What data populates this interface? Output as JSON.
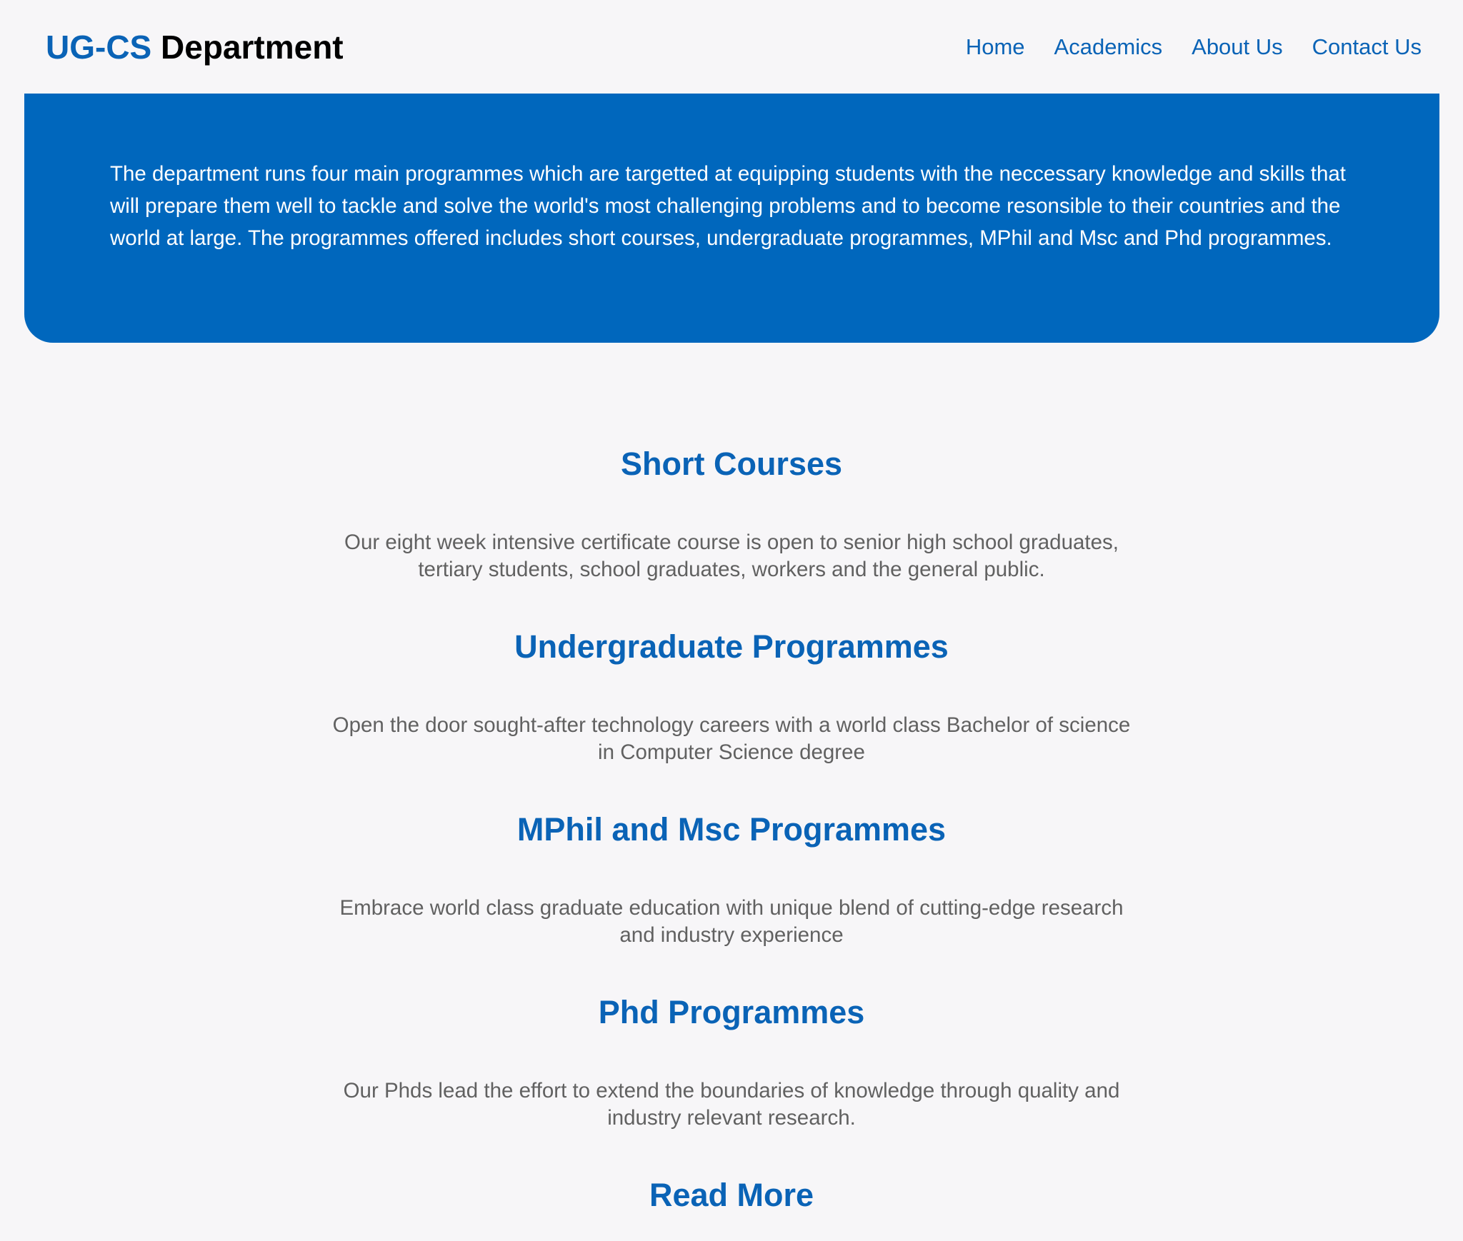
{
  "header": {
    "brand_accent": "UG-CS",
    "brand_rest": " Department",
    "nav": [
      "Home",
      "Academics",
      "About Us",
      "Contact Us"
    ]
  },
  "hero": {
    "text": "The department runs four main programmes which are targetted at equipping students with the neccessary knowledge and skills that will prepare them well to tackle and solve the world's most challenging problems and to become resonsible to their countries and the world at large. The programmes offered includes short courses, undergraduate programmes, MPhil and Msc and Phd programmes."
  },
  "programmes": [
    {
      "title": "Short Courses",
      "description": "Our eight week intensive certificate course is open to senior high school graduates, tertiary students, school graduates, workers and the general public."
    },
    {
      "title": "Undergraduate Programmes",
      "description": "Open the door sought-after technology careers with a world class Bachelor of science in Computer Science degree"
    },
    {
      "title": "MPhil and Msc Programmes",
      "description": "Embrace world class graduate education with unique blend of cutting-edge research and industry experience"
    },
    {
      "title": "Phd Programmes",
      "description": "Our Phds lead the effort to extend the boundaries of knowledge through quality and industry relevant research."
    }
  ],
  "read_more_label": "Read More",
  "colors": {
    "accent": "#0a63b6",
    "hero_bg": "#0067bd",
    "page_bg": "#f7f6f8",
    "body_text": "#616161"
  }
}
